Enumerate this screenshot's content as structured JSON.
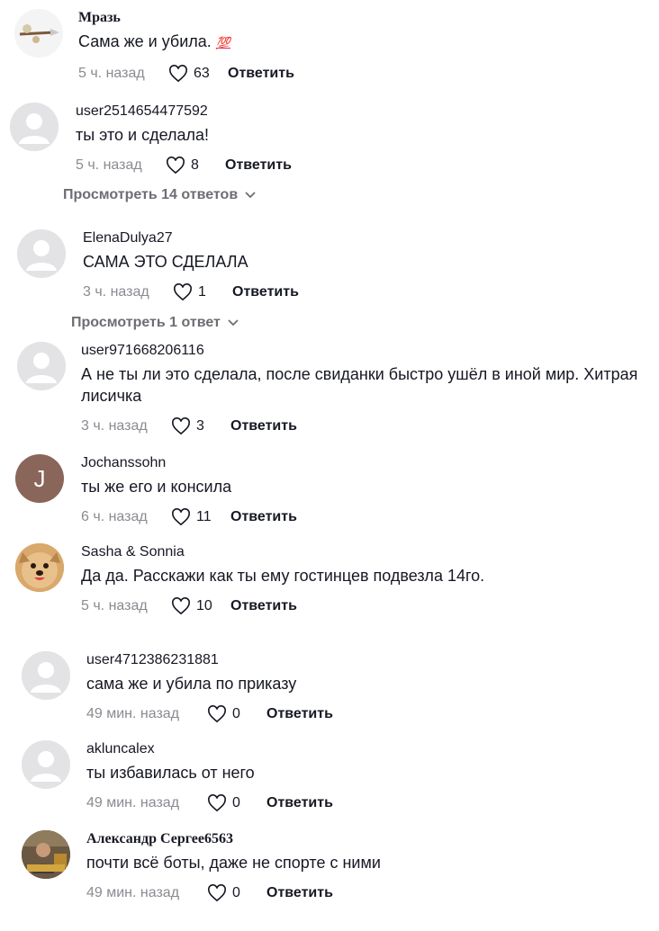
{
  "comments": [
    {
      "username": "Мразь",
      "text": "Сама же и убила.",
      "emoji": "💯",
      "time": "5 ч. назад",
      "likes": "63",
      "reply_label": "Ответить",
      "avatar": "paint-brush-avatar"
    },
    {
      "username": "user2514654477592",
      "text": "ты это и сделала!",
      "time": "5 ч. назад",
      "likes": "8",
      "reply_label": "Ответить",
      "avatar": "default-avatar",
      "view_replies": "Просмотреть 14 ответов"
    },
    {
      "username": "ElenaDulya27",
      "text": "САМА ЭТО СДЕЛАЛА",
      "time": "3 ч. назад",
      "likes": "1",
      "reply_label": "Ответить",
      "avatar": "default-avatar",
      "view_replies": "Просмотреть 1 ответ"
    },
    {
      "username": "user971668206116",
      "text": "А не ты ли это сделала, после свиданки быстро ушёл в иной мир. Хитрая лисичка",
      "time": "3 ч. назад",
      "likes": "3",
      "reply_label": "Ответить",
      "avatar": "default-avatar"
    },
    {
      "username": "Jochanssohn",
      "text": "ты же его и консила",
      "time": "6 ч. назад",
      "likes": "11",
      "reply_label": "Ответить",
      "avatar": "letter-avatar",
      "avatar_letter": "J"
    },
    {
      "username": "Sasha & Sonnia",
      "text": "Да да. Расскажи как ты ему гостинцев подвезла 14го.",
      "time": "5 ч. назад",
      "likes": "10",
      "reply_label": "Ответить",
      "avatar": "dog-photo-avatar"
    },
    {
      "username": "user4712386231881",
      "text": "сама же и убила по приказу",
      "time": "49 мин. назад",
      "likes": "0",
      "reply_label": "Ответить",
      "avatar": "default-avatar"
    },
    {
      "username": "akluncalex",
      "text": "ты избавилась от него",
      "time": "49 мин. назад",
      "likes": "0",
      "reply_label": "Ответить",
      "avatar": "default-avatar"
    },
    {
      "username": "Александр Сергее6563",
      "text": "почти всё боты, даже не спорте с ними",
      "time": "49 мин. назад",
      "likes": "0",
      "reply_label": "Ответить",
      "avatar": "person-photo-avatar"
    }
  ],
  "colors": {
    "text": "#161823",
    "muted": "#8a8b91",
    "avatar_bg": "#e3e3e5",
    "letter_avatar_bg": "#8a6559"
  }
}
